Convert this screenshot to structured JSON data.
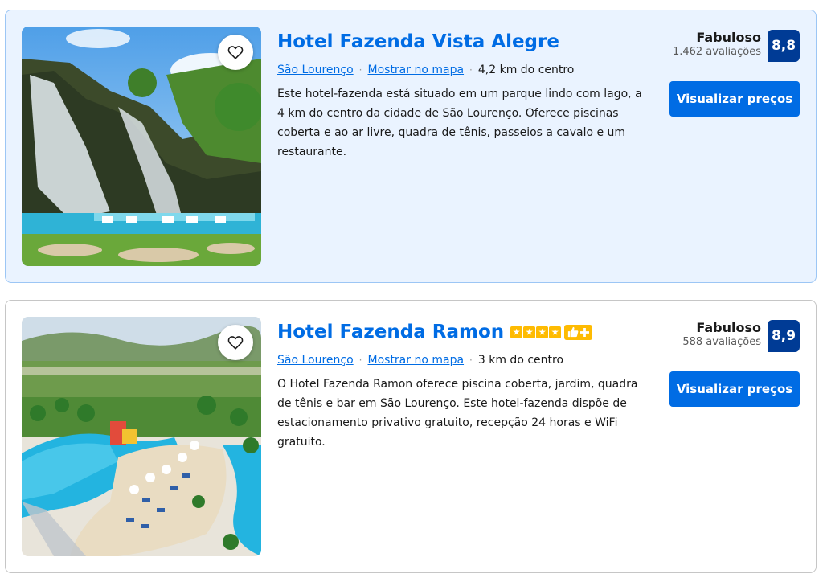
{
  "hotels": [
    {
      "name": "Hotel Fazenda Vista Alegre",
      "city_link": "São Lourenço",
      "map_link": "Mostrar no mapa",
      "distance": "4,2 km do centro",
      "description": "Este hotel-fazenda está situado em um parque lindo com lago, a 4 km do centro da cidade de São Lourenço. Oferece piscinas coberta e ao ar livre, quadra de tênis, passeios a cavalo e um restaurante.",
      "rating_word": "Fabuloso",
      "review_count": "1.462 avaliações",
      "score": "8,8",
      "cta": "Visualizar preços",
      "stars": 0,
      "featured": true,
      "photo_icon": "waterfall-pool-photo"
    },
    {
      "name": "Hotel Fazenda Ramon",
      "city_link": "São Lourenço",
      "map_link": "Mostrar no mapa",
      "distance": "3 km do centro",
      "description": "O Hotel Fazenda Ramon oferece piscina coberta, jardim, quadra de tênis e bar em São Lourenço. Este hotel-fazenda dispõe de estacionamento privativo gratuito, recepção 24 horas e WiFi gratuito.",
      "rating_word": "Fabuloso",
      "review_count": "588 avaliações",
      "score": "8,9",
      "cta": "Visualizar preços",
      "stars": 4,
      "preferred_badge": true,
      "featured": false,
      "photo_icon": "resort-aerial-photo"
    }
  ],
  "colors": {
    "link": "#006ce4",
    "score_bg": "#003b95",
    "featured_bg": "#eaf3ff",
    "star": "#febb02"
  },
  "icons": [
    "heart-icon",
    "star-icon",
    "thumbs-up-icon",
    "plus-icon"
  ]
}
